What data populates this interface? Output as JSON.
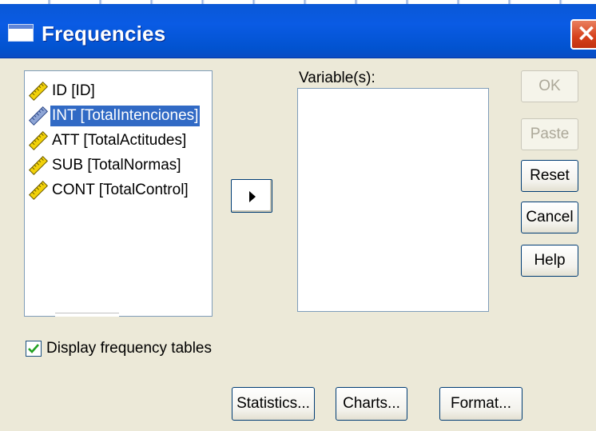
{
  "window": {
    "title": "Frequencies",
    "close_label": "×"
  },
  "source_list": {
    "items": [
      {
        "label": "ID [ID]",
        "icon": "ruler-icon",
        "selected": false
      },
      {
        "label": "INT [TotalIntenciones]",
        "icon": "ruler-icon",
        "selected": true
      },
      {
        "label": "ATT [TotalActitudes]",
        "icon": "ruler-icon",
        "selected": false
      },
      {
        "label": "SUB [TotalNormas]",
        "icon": "ruler-icon",
        "selected": false
      },
      {
        "label": "CONT [TotalControl]",
        "icon": "ruler-icon",
        "selected": false
      }
    ]
  },
  "target": {
    "label": "Variable(s):"
  },
  "move_button": {
    "icon": "right-arrow-icon"
  },
  "actions": {
    "ok": "OK",
    "paste": "Paste",
    "reset": "Reset",
    "cancel": "Cancel",
    "help": "Help"
  },
  "options": {
    "display_tables_label": "Display frequency tables",
    "display_tables_checked": true
  },
  "bottom_buttons": {
    "statistics": "Statistics...",
    "charts": "Charts...",
    "format": "Format..."
  },
  "colors": {
    "titlebar": "#0a58d6",
    "selection": "#316ac5",
    "dialog_bg": "#ece9d8",
    "close": "#d6401b"
  }
}
